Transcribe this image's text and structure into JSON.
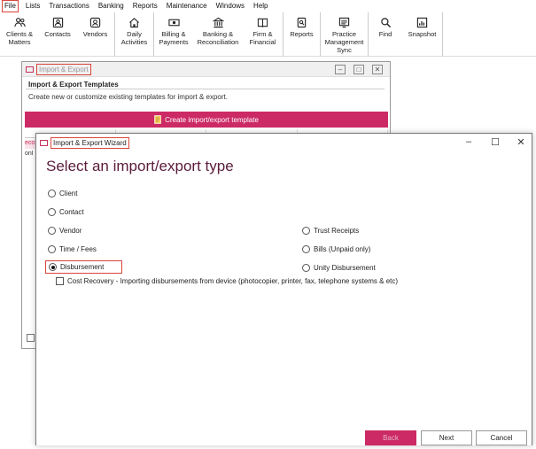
{
  "menubar": {
    "items": [
      "File",
      "Lists",
      "Transactions",
      "Banking",
      "Reports",
      "Maintenance",
      "Windows",
      "Help"
    ]
  },
  "toolbar": {
    "items": [
      {
        "label": "Clients &\nMatters",
        "icon": "people-icon"
      },
      {
        "label": "Contacts",
        "icon": "contact-card-icon"
      },
      {
        "label": "Vendors",
        "icon": "vendor-icon"
      },
      {
        "label": "Daily\nActivities",
        "icon": "home-icon"
      },
      {
        "label": "Billing &\nPayments",
        "icon": "money-icon"
      },
      {
        "label": "Banking &\nReconciliation",
        "icon": "bank-icon"
      },
      {
        "label": "Firm &\nFinancial",
        "icon": "book-icon"
      },
      {
        "label": "Reports",
        "icon": "report-icon"
      },
      {
        "label": "Practice\nManagement\nSync",
        "icon": "sync-icon"
      },
      {
        "label": "Find",
        "icon": "search-icon"
      },
      {
        "label": "Snapshot",
        "icon": "chart-icon"
      }
    ]
  },
  "import_export_window": {
    "title": "Import & Export",
    "heading": "Import & Export Templates",
    "description": "Create new or customize existing templates for import & export.",
    "create_button": "Create import/export template",
    "row_partial_1": "eco",
    "row_partial_2": "onl"
  },
  "wizard": {
    "title": "Import & Export Wizard",
    "heading": "Select an import/export type",
    "options_left": [
      "Client",
      "Contact",
      "Vendor",
      "Time / Fees",
      "Disbursement"
    ],
    "options_right": [
      "Trust Receipts",
      "Bills (Unpaid only)",
      "Unity Disbursement"
    ],
    "selected": "Disbursement",
    "cost_recovery_label": "Cost Recovery - Importing disbursements from device (photocopier, printer, fax, telephone systems & etc)",
    "buttons": {
      "back": "Back",
      "next": "Next",
      "cancel": "Cancel"
    }
  },
  "colors": {
    "accent": "#cc2a64",
    "title_text": "#5b1b3a",
    "highlight_box": "#d9443c"
  }
}
